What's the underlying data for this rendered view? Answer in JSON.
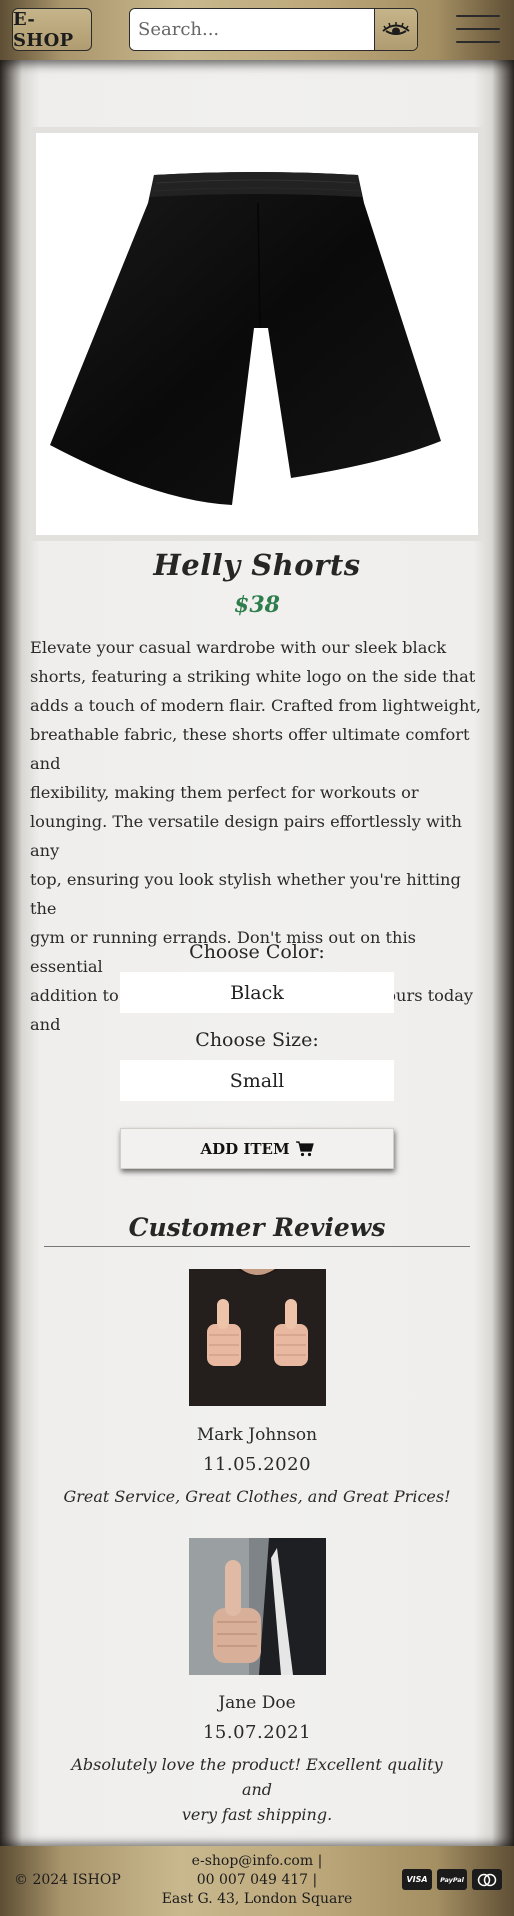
{
  "header": {
    "logo_label": "E-SHOP",
    "search": {
      "placeholder": "Search...",
      "icon": "eye-icon"
    },
    "menu_icon": "hamburger-icon"
  },
  "product": {
    "image_alt": "black shorts",
    "title": "Helly Shorts",
    "price": "$38",
    "description_lines": [
      "Elevate your casual wardrobe with our sleek black",
      "shorts, featuring a striking white logo on the side that",
      "adds a touch of modern flair. Crafted from lightweight,",
      "breathable fabric, these shorts offer ultimate comfort and",
      "flexibility, making them perfect for workouts or",
      "lounging. The versatile design pairs effortlessly with any",
      "top, ensuring you look stylish whether you're hitting the",
      "gym or running errands. Don't miss out on this essential",
      "addition to your summer collection—grab yours today",
      "and"
    ],
    "color_label": "Choose Color:",
    "color_value": "Black",
    "size_label": "Choose Size:",
    "size_value": "Small",
    "add_button_label": "ADD ITEM",
    "add_button_icon": "cart-icon"
  },
  "reviews": {
    "title": "Customer Reviews",
    "items": [
      {
        "name": "Mark Johnson",
        "date": "11.05.2020",
        "text_lines": [
          "Great Service, Great Clothes, and Great Prices!"
        ]
      },
      {
        "name": "Jane Doe",
        "date": "15.07.2021",
        "text_lines": [
          "Absolutely love the product! Excellent quality and",
          "very fast shipping."
        ]
      }
    ]
  },
  "footer": {
    "copyright": "© 2024 ISHOP",
    "email": "e-shop@info.com |",
    "phone": "00 007 049 417 |",
    "address": "East G. 43, London Square",
    "payments": [
      "VISA",
      "PayPal",
      "mastercard"
    ]
  },
  "colors": {
    "header_gold": "#bda97c",
    "price_green": "#2e7d4d",
    "background": "#f1f0ee"
  }
}
